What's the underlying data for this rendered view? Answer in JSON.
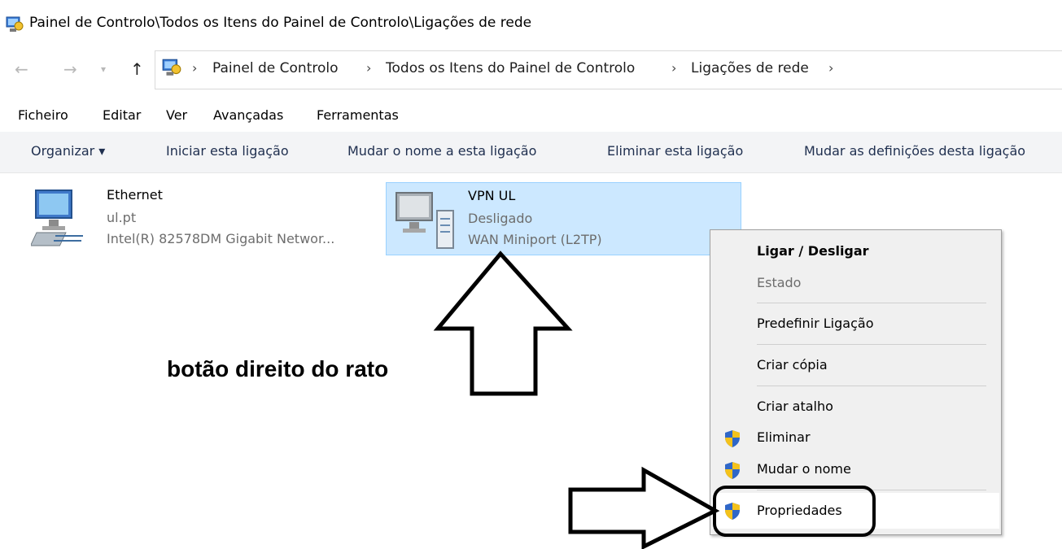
{
  "window": {
    "title": "Painel de Controlo\\Todos os Itens do Painel de Controlo\\Ligações de rede"
  },
  "addressbar": {
    "breadcrumbs": [
      "Painel de Controlo",
      "Todos os Itens do Painel de Controlo",
      "Ligações de rede"
    ],
    "icons": {
      "back": "arrow-left-icon",
      "forward": "arrow-right-icon",
      "recent": "chevron-down-icon",
      "up": "arrow-up-icon",
      "location": "control-panel-icon"
    }
  },
  "menubar": {
    "items": [
      "Ficheiro",
      "Editar",
      "Ver",
      "Avançadas",
      "Ferramentas"
    ]
  },
  "commandbar": {
    "organize": "Organizar ▾",
    "start": "Iniciar esta ligação",
    "rename": "Mudar o nome a esta ligação",
    "delete": "Eliminar esta ligação",
    "change_settings": "Mudar as definições desta ligação"
  },
  "connections": [
    {
      "name": "Ethernet",
      "status": "ul.pt",
      "device": "Intel(R) 82578DM Gigabit Networ...",
      "icon": "ethernet-adapter-icon"
    },
    {
      "name": "VPN UL",
      "status": "Desligado",
      "device": "WAN Miniport (L2TP)",
      "icon": "vpn-connection-icon"
    }
  ],
  "context_menu": {
    "items": [
      {
        "label": "Ligar / Desligar",
        "bold": true
      },
      {
        "label": "Estado",
        "disabled": true
      },
      {
        "label": "Predefinir Ligação"
      },
      {
        "label": "Criar cópia"
      },
      {
        "label": "Criar atalho"
      },
      {
        "label": "Eliminar",
        "icon": "uac-shield-icon"
      },
      {
        "label": "Mudar o nome",
        "icon": "uac-shield-icon"
      },
      {
        "label": "Propriedades",
        "icon": "uac-shield-icon",
        "highlighted": true
      }
    ]
  },
  "annotation": {
    "text": "botão direito do rato"
  },
  "colors": {
    "selection": "#cce8ff",
    "selection_border": "#99d1ff",
    "command_bar": "#f3f4f6",
    "menu_bg": "#f0f0f0"
  }
}
